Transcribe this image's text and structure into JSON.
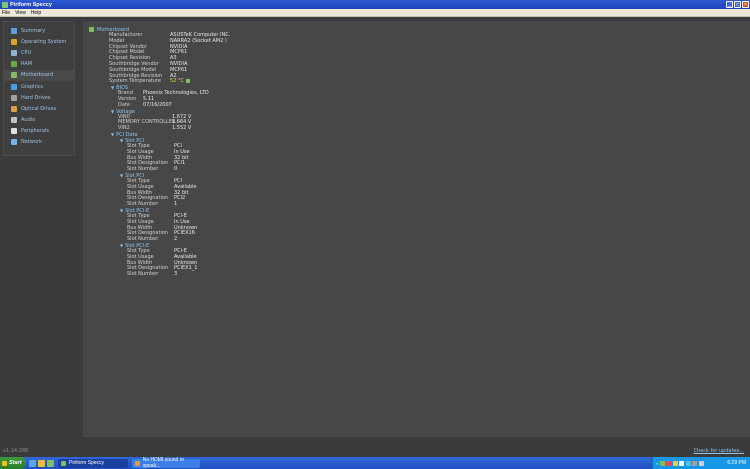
{
  "window": {
    "title": "Piriform Speccy"
  },
  "menu": [
    "File",
    "View",
    "Help"
  ],
  "sidebar": {
    "items": [
      {
        "label": "Summary",
        "icon": "summary-icon",
        "color": "#5aa0e0"
      },
      {
        "label": "Operating System",
        "icon": "windows-icon",
        "color": "#e0a020"
      },
      {
        "label": "CPU",
        "icon": "cpu-icon",
        "color": "#8fb2d8"
      },
      {
        "label": "RAM",
        "icon": "ram-icon",
        "color": "#5fae3c"
      },
      {
        "label": "Motherboard",
        "icon": "motherboard-icon",
        "color": "#7fbf5e"
      },
      {
        "label": "Graphics",
        "icon": "monitor-icon",
        "color": "#4aa0e8"
      },
      {
        "label": "Hard Drives",
        "icon": "hard-drive-icon",
        "color": "#a0a0a0"
      },
      {
        "label": "Optical Drives",
        "icon": "optical-drive-icon",
        "color": "#d8a040"
      },
      {
        "label": "Audio",
        "icon": "speaker-icon",
        "color": "#c0c0c0"
      },
      {
        "label": "Peripherals",
        "icon": "mouse-icon",
        "color": "#e0e0e0"
      },
      {
        "label": "Network",
        "icon": "network-icon",
        "color": "#6fb7e8"
      }
    ]
  },
  "main": {
    "section_title": "Motherboard",
    "properties": [
      {
        "k": "Manufacturer",
        "v": "ASUSTeK Computer INC."
      },
      {
        "k": "Model",
        "v": "NARRA2 (Socket AM2 )"
      },
      {
        "k": "Chipset Vendor",
        "v": "NVIDIA"
      },
      {
        "k": "Chipset Model",
        "v": "MCP61"
      },
      {
        "k": "Chipset Revision",
        "v": "A3"
      },
      {
        "k": "Southbridge Vendor",
        "v": "NVIDIA"
      },
      {
        "k": "Southbridge Model",
        "v": "MCP61"
      },
      {
        "k": "Southbridge Revision",
        "v": "A2"
      },
      {
        "k": "System Temperature",
        "v": "52 °C"
      }
    ],
    "bios": {
      "label": "BIOS",
      "rows": [
        {
          "k": "Brand",
          "v": "Phoenix Technologies, LTD"
        },
        {
          "k": "Version",
          "v": "5.11"
        },
        {
          "k": "Date",
          "v": "07/16/2007"
        }
      ]
    },
    "voltage": {
      "label": "Voltage",
      "rows": [
        {
          "k": "VIN0",
          "v": "1.672 V"
        },
        {
          "k": "MEMORY CONTROLLER",
          "v": "1.664 V"
        },
        {
          "k": "VIN2",
          "v": "1.552 V"
        }
      ]
    },
    "pci": {
      "label": "PCI Data",
      "slots": [
        {
          "label": "Slot PCI",
          "rows": [
            {
              "k": "Slot Type",
              "v": "PCI"
            },
            {
              "k": "Slot Usage",
              "v": "In Use"
            },
            {
              "k": "Bus Width",
              "v": "32 bit"
            },
            {
              "k": "Slot Designation",
              "v": "PCI1"
            },
            {
              "k": "Slot Number",
              "v": "0"
            }
          ]
        },
        {
          "label": "Slot PCI",
          "rows": [
            {
              "k": "Slot Type",
              "v": "PCI"
            },
            {
              "k": "Slot Usage",
              "v": "Available"
            },
            {
              "k": "Bus Width",
              "v": "32 bit"
            },
            {
              "k": "Slot Designation",
              "v": "PCI2"
            },
            {
              "k": "Slot Number",
              "v": "1"
            }
          ]
        },
        {
          "label": "Slot PCI-E",
          "rows": [
            {
              "k": "Slot Type",
              "v": "PCI-E"
            },
            {
              "k": "Slot Usage",
              "v": "In Use"
            },
            {
              "k": "Bus Width",
              "v": "Unknown"
            },
            {
              "k": "Slot Designation",
              "v": "PCIEX16"
            },
            {
              "k": "Slot Number",
              "v": "2"
            }
          ]
        },
        {
          "label": "Slot PCI-E",
          "rows": [
            {
              "k": "Slot Type",
              "v": "PCI-E"
            },
            {
              "k": "Slot Usage",
              "v": "Available"
            },
            {
              "k": "Bus Width",
              "v": "Unknown"
            },
            {
              "k": "Slot Designation",
              "v": "PCIEX1_1"
            },
            {
              "k": "Slot Number",
              "v": "3"
            }
          ]
        }
      ]
    }
  },
  "status": {
    "version": "v1.14.288",
    "update_link": "Check for updates..."
  },
  "taskbar": {
    "start": "Start",
    "tasks": [
      {
        "label": "Piriform Speccy",
        "active": true
      },
      {
        "label": "No HDMI sound or speak...",
        "active": false
      }
    ],
    "clock": "6:29 PM"
  },
  "colors": {
    "accent_text": "#8fc4ee",
    "panel_bg": "#474747",
    "window_bg": "#3b3b3b",
    "taskbar": "#1f4fc2"
  }
}
